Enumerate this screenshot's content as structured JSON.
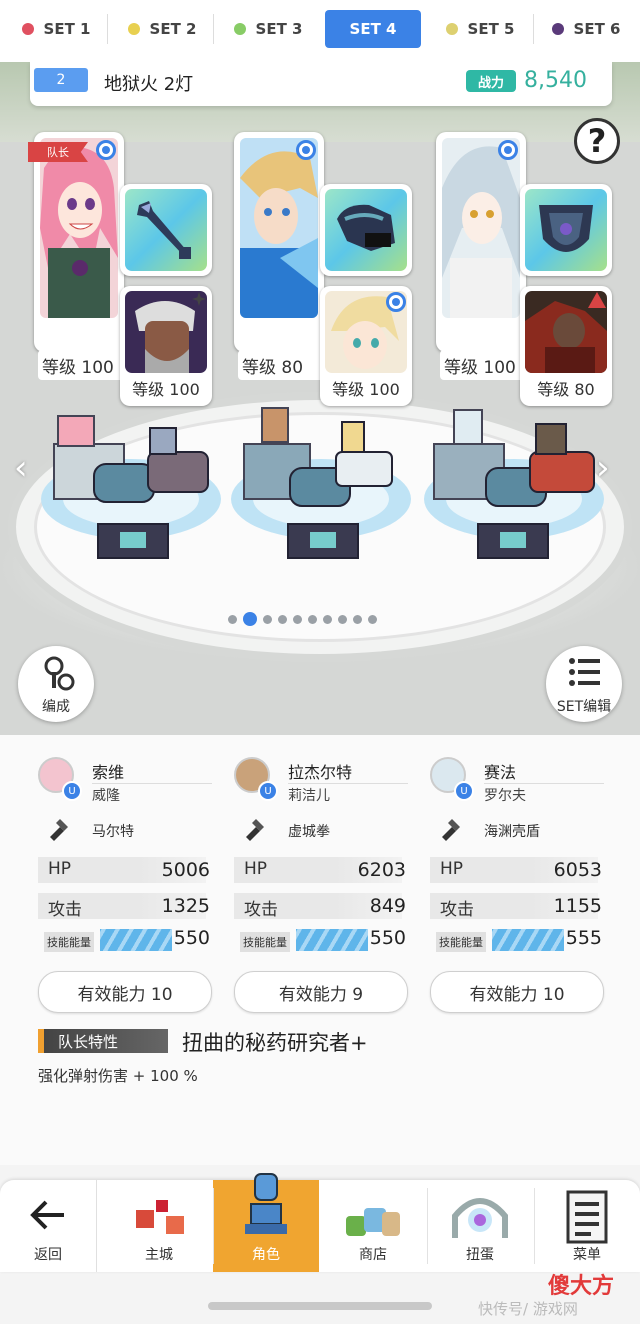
{
  "tabs": [
    {
      "label": "SET 1",
      "color": "#e05060"
    },
    {
      "label": "SET 2",
      "color": "#e8d050"
    },
    {
      "label": "SET 3",
      "color": "#88cc66"
    },
    {
      "label": "SET 4",
      "color": "#ffffff",
      "active": true
    },
    {
      "label": "SET 5",
      "color": "#ddd070"
    },
    {
      "label": "SET 6",
      "color": "#5a3a7a"
    }
  ],
  "team": {
    "number": "2",
    "name": "地狱火 2灯",
    "power_label": "战力",
    "power_value": "8,540"
  },
  "help_symbol": "?",
  "leader_badge": "队长",
  "characters": [
    {
      "level": "等级 100",
      "hero_level": "等级 100"
    },
    {
      "level": "等级 80",
      "hero_level": "等级 100"
    },
    {
      "level": "等级 100",
      "hero_level": "等级 80"
    }
  ],
  "arrows": {
    "left": "‹",
    "right": "›"
  },
  "page_dots": {
    "count": 10,
    "active": 1
  },
  "buttons": {
    "formation": "编成",
    "set_edit": "SET编辑"
  },
  "stats": [
    {
      "name": "索维",
      "sub": "威隆",
      "weapon": "马尔特",
      "hp_label": "HP",
      "hp": "5006",
      "atk_label": "攻击",
      "atk": "1325",
      "skill_label": "技能能量",
      "skill": "550",
      "ability": "有效能力 10"
    },
    {
      "name": "拉杰尔特",
      "sub": "莉洁儿",
      "weapon": "虚城拳",
      "hp_label": "HP",
      "hp": "6203",
      "atk_label": "攻击",
      "atk": "849",
      "skill_label": "技能能量",
      "skill": "550",
      "ability": "有效能力 9"
    },
    {
      "name": "赛法",
      "sub": "罗尔夫",
      "weapon": "海渊壳盾",
      "hp_label": "HP",
      "hp": "6053",
      "atk_label": "攻击",
      "atk": "1155",
      "skill_label": "技能能量",
      "skill": "555",
      "ability": "有效能力 10"
    }
  ],
  "leader_trait": {
    "tag": "队长特性",
    "name": "扭曲的秘药研究者+",
    "desc": "强化弹射伤害 + 100 %"
  },
  "nav": {
    "back": "返回",
    "items": [
      "主城",
      "角色",
      "商店",
      "扭蛋",
      "菜单"
    ],
    "active": 1
  },
  "watermark": {
    "brand": "傻大方",
    "site": "快传号/ 游戏网"
  }
}
